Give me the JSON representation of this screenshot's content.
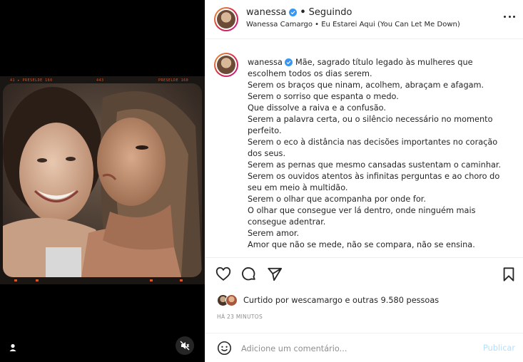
{
  "header": {
    "username": "wanessa",
    "separator": "•",
    "follow_status": "Seguindo",
    "audio": "Wanessa Camargo • Eu Estarei Aqui (You Can Let Me Down)"
  },
  "caption": {
    "username": "wanessa",
    "lines": [
      "Mãe, sagrado título legado às mulheres que",
      "escolhem todos os dias serem.",
      "Serem os braços que ninam, acolhem, abraçam e afagam.",
      "Serem o sorriso que espanta o medo.",
      "Que dissolve a raiva e a confusão.",
      "Serem a palavra certa, ou o silêncio necessário no momento",
      "perfeito.",
      "Serem o eco à distância nas decisões importantes no coração",
      "dos seus.",
      "Serem as pernas que mesmo cansadas sustentam o caminhar.",
      "Serem os ouvidos atentos às infinitas perguntas e ao choro do",
      "seu em meio à multidão.",
      "Serem o olhar que acompanha por onde for.",
      "O olhar que consegue ver lá dentro, onde ninguém mais",
      "consegue adentrar.",
      "Serem amor.",
      "Amor que não se mede, não se compara, não se ensina."
    ]
  },
  "likes": {
    "text": "Curtido por wescamargo e outras 9.580 pessoas"
  },
  "time_ago": "HÁ 23 MINUTOS",
  "comment": {
    "placeholder": "Adicione um comentário...",
    "post_label": "Publicar"
  },
  "film": {
    "top_left": "41 ▸  PRESELDE 160",
    "top_mid": "443",
    "top_right": "PRESELDE 160",
    "bottom_marks": [
      "▸",
      "▸▸",
      "▸",
      "▸▸"
    ]
  },
  "colors": {
    "accent_blue": "#3897f0",
    "film_orange": "#d7542a",
    "muted_text": "#8e8e8e",
    "post_disabled": "#b2dffc"
  },
  "icons": [
    "user-tag-icon",
    "mute-icon",
    "more-options-icon",
    "verified-badge-icon",
    "heart-icon",
    "comment-icon",
    "share-icon",
    "bookmark-icon",
    "emoji-icon"
  ]
}
